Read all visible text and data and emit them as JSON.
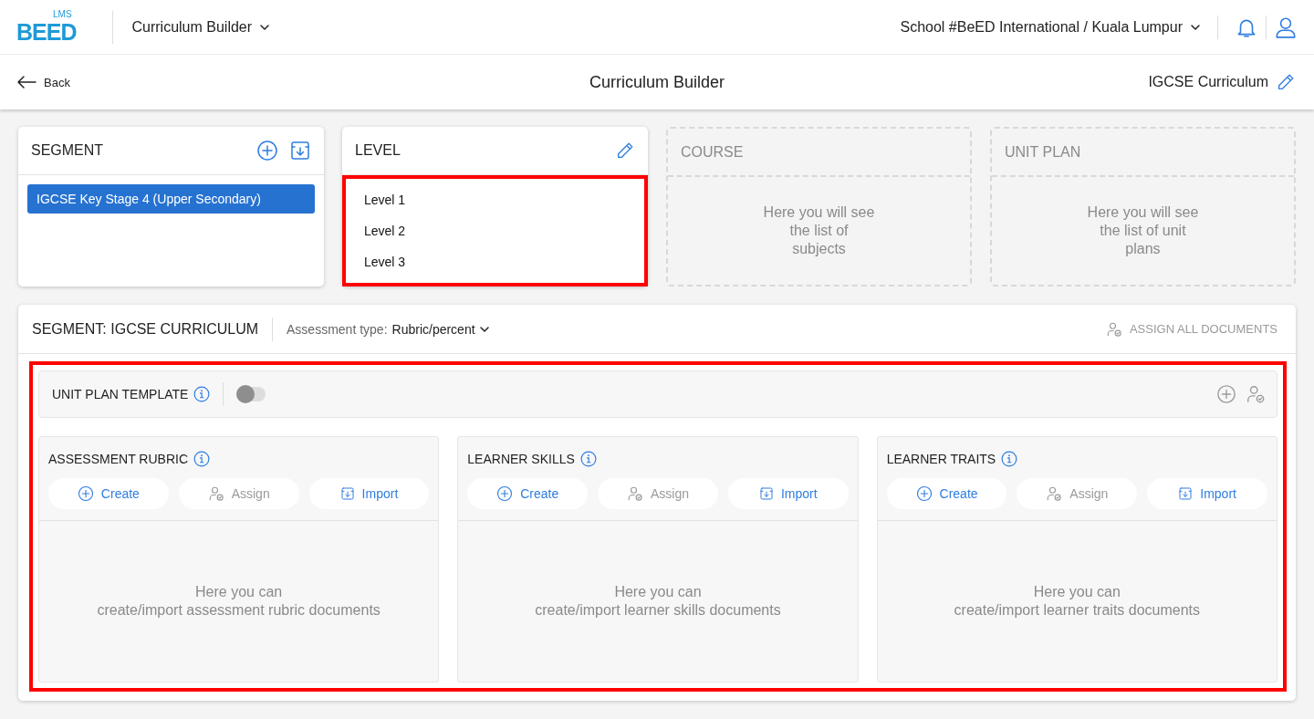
{
  "topbar": {
    "logo": {
      "mark": "BEED",
      "sub": "LMS"
    },
    "module": "Curriculum Builder",
    "school": "School #BeED International / Kuala Lumpur"
  },
  "subheader": {
    "back": "Back",
    "title": "Curriculum Builder",
    "curriculum": "IGCSE Curriculum"
  },
  "columns": [
    {
      "kind": "list",
      "title": "SEGMENT",
      "actions": [
        {
          "kind": "add"
        },
        {
          "kind": "import"
        }
      ],
      "highlighted": false,
      "items": [
        {
          "label": "IGCSE Key Stage 4 (Upper Secondary)",
          "selected": true
        }
      ]
    },
    {
      "kind": "list",
      "title": "LEVEL",
      "actions": [
        {
          "kind": "edit"
        }
      ],
      "highlighted": true,
      "items": [
        {
          "label": "Level 1",
          "selected": false
        },
        {
          "label": "Level 2",
          "selected": false
        },
        {
          "label": "Level 3",
          "selected": false
        }
      ]
    },
    {
      "kind": "empty",
      "title": "COURSE",
      "message": "Here you will see\nthe list of\nsubjects"
    },
    {
      "kind": "empty",
      "title": "UNIT PLAN",
      "message": "Here you will see\nthe list of unit\nplans"
    }
  ],
  "segment_panel": {
    "title": "SEGMENT: IGCSE CURRICULUM",
    "assessment_label": "Assessment type:",
    "assessment_value": "Rubric/percent",
    "assign_all": "ASSIGN ALL DOCUMENTS",
    "highlighted": true,
    "template": {
      "title": "UNIT PLAN TEMPLATE",
      "on": false
    },
    "documents": [
      {
        "title": "ASSESSMENT RUBRIC",
        "message": "Here you can\ncreate/import assessment rubric documents",
        "buttons": [
          {
            "kind": "create",
            "label": "Create",
            "disabled": false
          },
          {
            "kind": "assign",
            "label": "Assign",
            "disabled": true
          },
          {
            "kind": "import",
            "label": "Import",
            "disabled": false
          }
        ]
      },
      {
        "title": "LEARNER SKILLS",
        "message": "Here you can\ncreate/import learner skills documents",
        "buttons": [
          {
            "kind": "create",
            "label": "Create",
            "disabled": false
          },
          {
            "kind": "assign",
            "label": "Assign",
            "disabled": true
          },
          {
            "kind": "import",
            "label": "Import",
            "disabled": false
          }
        ]
      },
      {
        "title": "LEARNER TRAITS",
        "message": "Here you can\ncreate/import learner traits documents",
        "buttons": [
          {
            "kind": "create",
            "label": "Create",
            "disabled": false
          },
          {
            "kind": "assign",
            "label": "Assign",
            "disabled": true
          },
          {
            "kind": "import",
            "label": "Import",
            "disabled": false
          }
        ]
      }
    ]
  }
}
